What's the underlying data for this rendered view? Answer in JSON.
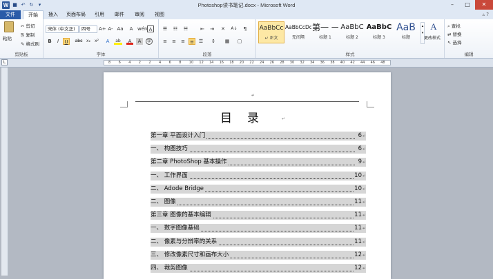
{
  "window": {
    "title": "Photoshop读书笔记.docx - Microsoft Word",
    "app_logo": "W",
    "controls": {
      "minimize": "–",
      "maximize": "□",
      "close": "✕"
    }
  },
  "qat": {
    "save": "■",
    "undo": "↶",
    "redo": "↻",
    "more": "▾"
  },
  "tabs": [
    {
      "label": "文件"
    },
    {
      "label": "开始"
    },
    {
      "label": "插入"
    },
    {
      "label": "页面布局"
    },
    {
      "label": "引用"
    },
    {
      "label": "邮件"
    },
    {
      "label": "审阅"
    },
    {
      "label": "视图"
    }
  ],
  "tab_right": "▵ ?",
  "ribbon": {
    "clipboard": {
      "label": "剪贴板",
      "paste": "粘贴",
      "cut": "剪切",
      "copy": "复制",
      "format_painter": "格式刷"
    },
    "font": {
      "label": "字体",
      "name": "宋体 (中文正)",
      "size": "四号",
      "grow": "A+",
      "shrink": "A-",
      "case": "Aa",
      "clear": "A",
      "pinyin": "wén",
      "border_a": "A",
      "bold": "B",
      "italic": "I",
      "underline": "U",
      "strike": "abc",
      "subscript": "x₂",
      "superscript": "x²",
      "effects": "A",
      "highlight": "ab",
      "font_color": "A",
      "shading": "A",
      "enclose": "字"
    },
    "paragraph": {
      "label": "段落",
      "bullets": "☰",
      "numbering": "☷",
      "multilevel": "☵",
      "decrease_indent": "⇤",
      "increase_indent": "⇥",
      "chinese_layout": "✕",
      "sort": "A↓",
      "show_marks": "¶",
      "align_left": "≡",
      "center": "≡",
      "align_right": "≡",
      "justify": "≡",
      "distributed": "☰",
      "line_spacing": "↕",
      "shading": "▦",
      "borders": "▢"
    },
    "styles": {
      "label": "样式",
      "change_styles": "更改样式",
      "items": [
        {
          "preview": "AaBbCc",
          "name": "↵ 正文"
        },
        {
          "preview": "AaBbCcDc",
          "name": "无间隔"
        },
        {
          "preview": "第一 一",
          "name": "标题 1"
        },
        {
          "preview": "AaBbC",
          "name": "标题 2"
        },
        {
          "preview": "AaBbC",
          "name": "标题 3"
        },
        {
          "preview": "AaB",
          "name": "标题"
        }
      ]
    },
    "editing": {
      "label": "编辑",
      "find": "查找",
      "replace": "替换",
      "select": "选择"
    }
  },
  "ruler": {
    "numbers": [
      "8",
      "6",
      "4",
      "2",
      "2",
      "4",
      "6",
      "8",
      "10",
      "12",
      "14",
      "16",
      "18",
      "20",
      "22",
      "24",
      "26",
      "28",
      "30",
      "32",
      "34",
      "36",
      "38",
      "40",
      "42",
      "44",
      "46",
      "48"
    ],
    "corner": "L"
  },
  "document": {
    "header_mark": "↵",
    "title": "目录",
    "title_mark": "↵",
    "entries": [
      {
        "text": "第一章  平面设计入门",
        "page": "6",
        "level": 1
      },
      {
        "text": "一、    构图技巧",
        "page": "6",
        "level": 2
      },
      {
        "text": "第二章  PhotoShop 基本操作",
        "page": "9",
        "level": 1
      },
      {
        "text": "一、    工作界面",
        "page": "10",
        "level": 2
      },
      {
        "text": "二、    Adode Bridge",
        "page": "10",
        "level": 2
      },
      {
        "text": "二、    图像",
        "page": "11",
        "level": 2
      },
      {
        "text": "第三章  图像的基本编辑",
        "page": "11",
        "level": 1
      },
      {
        "text": "一、    数字图像基础",
        "page": "11",
        "level": 2
      },
      {
        "text": "二、    像素与分辨率的关系",
        "page": "11",
        "level": 2
      },
      {
        "text": "三、    修改像素尺寸和画布大小",
        "page": "12",
        "level": 2
      },
      {
        "text": "四、    裁剪图像",
        "page": "12",
        "level": 2
      }
    ],
    "para_mark": "↵"
  }
}
